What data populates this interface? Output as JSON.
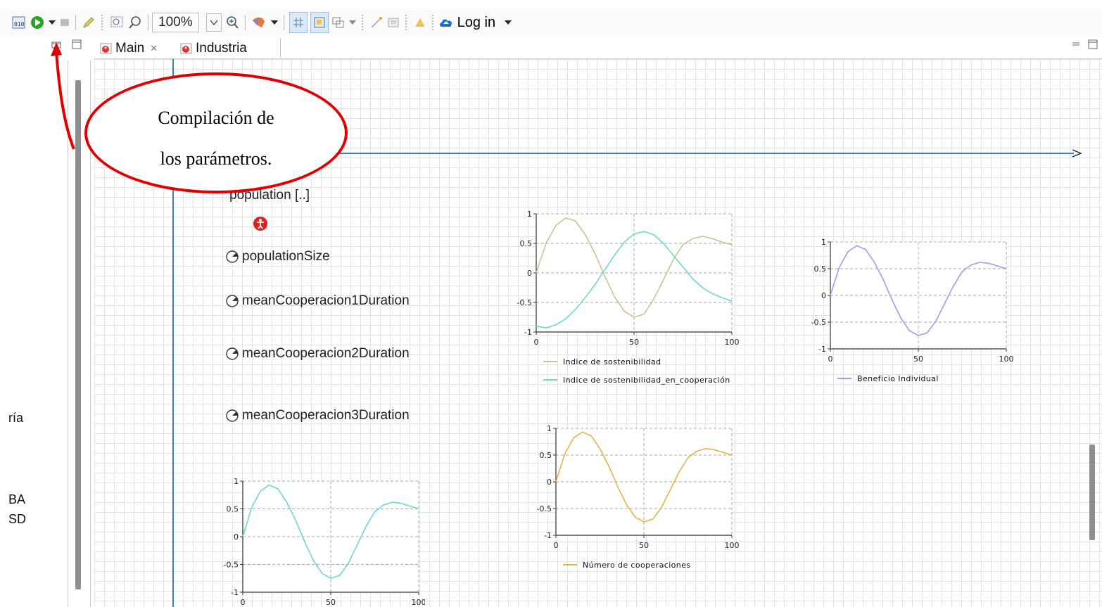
{
  "toolbar": {
    "zoom": "100%",
    "login_label": "Log in",
    "colors": {
      "run": "#2aa32a",
      "login_cloud": "#1a73c9",
      "build": "#4a7ab4"
    }
  },
  "tabs": [
    {
      "label": "Main",
      "active": true,
      "closable": true
    },
    {
      "label": "Industria",
      "active": false,
      "closable": false
    }
  ],
  "left_panel": {
    "labels": [
      "ría",
      "BA",
      "SD"
    ]
  },
  "canvas": {
    "population_label": "population [..]",
    "parameters": [
      "populationSize",
      "meanCooperacion1Duration",
      "meanCooperacion2Duration",
      "meanCooperacion3Duration"
    ]
  },
  "callout": {
    "line1": "Compilación de",
    "line2": "los parámetros."
  },
  "chart_data": [
    {
      "type": "line",
      "x": [
        0,
        5,
        10,
        15,
        20,
        25,
        30,
        35,
        40,
        45,
        50,
        55,
        60,
        65,
        70,
        75,
        80,
        85,
        90,
        95,
        100
      ],
      "xlim": [
        0,
        100
      ],
      "ylim": [
        -1,
        1
      ],
      "xticks": [
        "0",
        "50",
        "100"
      ],
      "yticks": [
        "1",
        "0.5",
        "0",
        "-0.5",
        "-1"
      ],
      "grid": true,
      "legend_position": "bottom",
      "series": [
        {
          "name": "Indice de sostenibilidad",
          "color": "#cfc08f",
          "values": [
            0,
            0.5,
            0.8,
            0.93,
            0.88,
            0.65,
            0.33,
            -0.05,
            -0.4,
            -0.65,
            -0.75,
            -0.7,
            -0.45,
            -0.12,
            0.22,
            0.48,
            0.58,
            0.62,
            0.58,
            0.52,
            0.48
          ]
        },
        {
          "name": "Indice de sostenibilidad_en_cooperación",
          "color": "#6fd5d0",
          "values": [
            -0.9,
            -0.93,
            -0.88,
            -0.78,
            -0.62,
            -0.42,
            -0.2,
            0.05,
            0.3,
            0.52,
            0.66,
            0.7,
            0.65,
            0.5,
            0.3,
            0.1,
            -0.1,
            -0.25,
            -0.35,
            -0.42,
            -0.48
          ]
        }
      ]
    },
    {
      "type": "line",
      "x": [
        0,
        5,
        10,
        15,
        20,
        25,
        30,
        35,
        40,
        45,
        50,
        55,
        60,
        65,
        70,
        75,
        80,
        85,
        90,
        95,
        100
      ],
      "xlim": [
        0,
        100
      ],
      "ylim": [
        -1,
        1
      ],
      "xticks": [
        "0",
        "50",
        "100"
      ],
      "yticks": [
        "1",
        "0.5",
        "0",
        "-0.5",
        "-1"
      ],
      "grid": true,
      "legend_position": "bottom",
      "series": [
        {
          "name": "Beneficio Individual",
          "color": "#a39af5",
          "values": [
            0,
            0.52,
            0.82,
            0.93,
            0.86,
            0.62,
            0.3,
            -0.08,
            -0.42,
            -0.66,
            -0.75,
            -0.7,
            -0.48,
            -0.15,
            0.18,
            0.45,
            0.57,
            0.62,
            0.6,
            0.55,
            0.5
          ]
        }
      ]
    },
    {
      "type": "line",
      "x": [
        0,
        5,
        10,
        15,
        20,
        25,
        30,
        35,
        40,
        45,
        50,
        55,
        60,
        65,
        70,
        75,
        80,
        85,
        90,
        95,
        100
      ],
      "xlim": [
        0,
        100
      ],
      "ylim": [
        -1,
        1
      ],
      "xticks": [
        "0",
        "50",
        "100"
      ],
      "yticks": [
        "1",
        "0.5",
        "0",
        "-0.5",
        "-1"
      ],
      "grid": true,
      "legend_position": "bottom",
      "series": [
        {
          "name": "Número de cooperaciones",
          "color": "#e7b24c",
          "values": [
            0,
            0.52,
            0.82,
            0.93,
            0.86,
            0.62,
            0.3,
            -0.08,
            -0.42,
            -0.66,
            -0.75,
            -0.7,
            -0.48,
            -0.15,
            0.18,
            0.45,
            0.57,
            0.62,
            0.6,
            0.55,
            0.5
          ]
        }
      ]
    },
    {
      "type": "line",
      "x": [
        0,
        5,
        10,
        15,
        20,
        25,
        30,
        35,
        40,
        45,
        50,
        55,
        60,
        65,
        70,
        75,
        80,
        85,
        90,
        95,
        100
      ],
      "xlim": [
        0,
        100
      ],
      "ylim": [
        -1,
        1
      ],
      "xticks": [
        "0",
        "50",
        "100"
      ],
      "yticks": [
        "1",
        "0.5",
        "0",
        "-0.5",
        "-1"
      ],
      "grid": true,
      "legend_position": "none",
      "series": [
        {
          "color": "#6fd5d0",
          "values": [
            0,
            0.52,
            0.82,
            0.93,
            0.86,
            0.62,
            0.3,
            -0.08,
            -0.42,
            -0.66,
            -0.75,
            -0.7,
            -0.48,
            -0.15,
            0.18,
            0.45,
            0.57,
            0.62,
            0.6,
            0.55,
            0.5
          ]
        }
      ]
    }
  ]
}
